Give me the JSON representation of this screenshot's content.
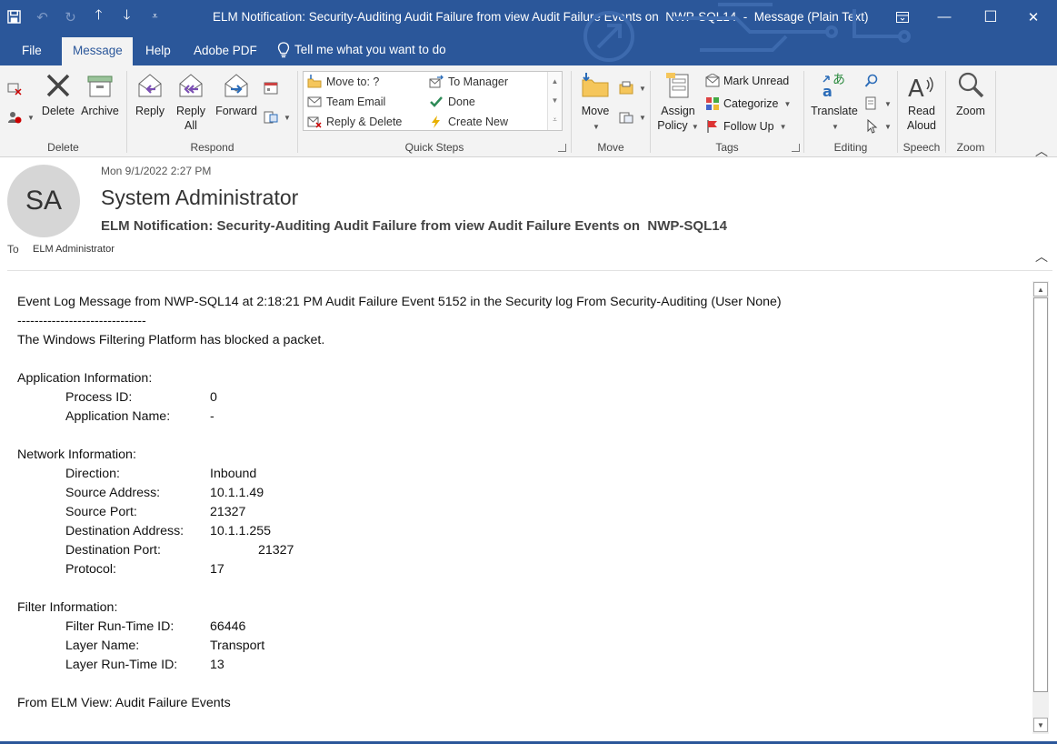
{
  "window": {
    "title": "ELM Notification: Security-Auditing Audit Failure from view Audit Failure Events on  NWP-SQL14  -  Message (Plain Text)",
    "controls": {
      "restore_ribbon": "ribbon-display-icon",
      "minimize": "—",
      "maximize": "☐",
      "close": "✕"
    }
  },
  "qat": [
    "save-icon",
    "undo-icon",
    "redo-icon",
    "previous-item-icon",
    "next-item-icon",
    "customize-icon"
  ],
  "tabs": [
    {
      "label": "File"
    },
    {
      "label": "Message",
      "active": true
    },
    {
      "label": "Help"
    },
    {
      "label": "Adobe PDF"
    }
  ],
  "tell_me": "Tell me what you want to do",
  "ribbon": {
    "delete": {
      "label": "Delete",
      "buttons": {
        "delete": "Delete",
        "archive": "Archive"
      }
    },
    "respond": {
      "label": "Respond",
      "buttons": {
        "reply": "Reply",
        "reply_all_1": "Reply",
        "reply_all_2": "All",
        "forward": "Forward"
      }
    },
    "quick_steps": {
      "label": "Quick Steps",
      "items": {
        "move_to": "Move to: ?",
        "to_manager": "To Manager",
        "team_email": "Team Email",
        "done": "Done",
        "reply_delete": "Reply & Delete",
        "create_new": "Create New"
      }
    },
    "move": {
      "label": "Move",
      "buttons": {
        "move": "Move"
      }
    },
    "tags": {
      "label": "Tags",
      "buttons": {
        "assign_policy_1": "Assign",
        "assign_policy_2": "Policy",
        "mark_unread": "Mark Unread",
        "categorize": "Categorize",
        "follow_up": "Follow Up"
      }
    },
    "editing": {
      "label": "Editing",
      "buttons": {
        "translate": "Translate"
      }
    },
    "speech": {
      "label": "Speech",
      "buttons": {
        "read_aloud_1": "Read",
        "read_aloud_2": "Aloud"
      }
    },
    "zoom": {
      "label": "Zoom",
      "buttons": {
        "zoom": "Zoom"
      }
    }
  },
  "header": {
    "avatar_initials": "SA",
    "date": "Mon 9/1/2022 2:27 PM",
    "from": "System Administrator",
    "subject": "ELM Notification: Security-Auditing Audit Failure from view Audit Failure Events on  NWP-SQL14",
    "to_label": "To",
    "to_value": "ELM Administrator"
  },
  "message": {
    "line1": "Event Log Message from NWP-SQL14 at 2:18:21 PM Audit Failure Event 5152 in the Security log From Security-Auditing (User None)",
    "divider": "------------------------------",
    "line2": "The Windows Filtering Platform has blocked a packet.",
    "app_heading": "Application Information:",
    "app": [
      {
        "k": "Process ID:",
        "v": "0"
      },
      {
        "k": "Application Name:",
        "v": "-"
      }
    ],
    "net_heading": "Network Information:",
    "net": [
      {
        "k": "Direction:",
        "v": "Inbound"
      },
      {
        "k": "Source Address:",
        "v": "10.1.1.49"
      },
      {
        "k": "Source Port:",
        "v": "21327"
      },
      {
        "k": "Destination Address:",
        "v": "10.1.1.255"
      },
      {
        "k": "Destination Port:",
        "v": "21327"
      },
      {
        "k": "Protocol:",
        "v": "17"
      }
    ],
    "filter_heading": "Filter Information:",
    "filter": [
      {
        "k": "Filter Run-Time ID:",
        "v": "66446"
      },
      {
        "k": "Layer Name:",
        "v": "Transport"
      },
      {
        "k": "Layer Run-Time ID:",
        "v": "13"
      }
    ],
    "footer": "From ELM View: Audit Failure Events"
  },
  "colors": {
    "accent": "#2b579a",
    "ribbon_bg": "#f3f3f3",
    "avatar_bg": "#d6d6d6"
  }
}
